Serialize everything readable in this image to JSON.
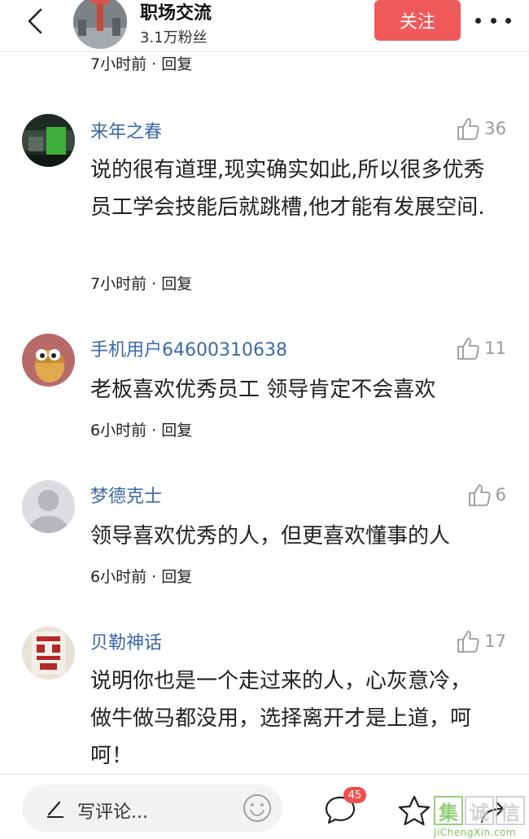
{
  "header": {
    "channel_name": "职场交流",
    "fans": "3.1万粉丝",
    "follow_label": "关注"
  },
  "top_meta": "7小时前 · 回复",
  "comments": [
    {
      "user": "来年之春",
      "likes": "36",
      "text": "说的很有道理,现实确实如此,所以很多优秀员工学会技能后就跳槽,他才能有发展空间.",
      "meta": "7小时前 · 回复"
    },
    {
      "user": "手机用户64600310638",
      "likes": "11",
      "text": "老板喜欢优秀员工 领导肯定不会喜欢",
      "meta": "6小时前 · 回复"
    },
    {
      "user": "梦德克士",
      "likes": "6",
      "text": "领导喜欢优秀的人，但更喜欢懂事的人",
      "meta": "6小时前 · 回复"
    },
    {
      "user": "贝勒神话",
      "likes": "17",
      "text": "说明你也是一个走过来的人，心灰意冷，做牛做马都没用，选择离开才是上道，呵呵！",
      "meta": ""
    }
  ],
  "bottom_bar": {
    "comment_placeholder": "写评论...",
    "comment_count_badge": "45"
  },
  "watermark": {
    "logo_chars": [
      "集",
      "诚",
      "信"
    ],
    "url": "JiChengXin.com"
  }
}
